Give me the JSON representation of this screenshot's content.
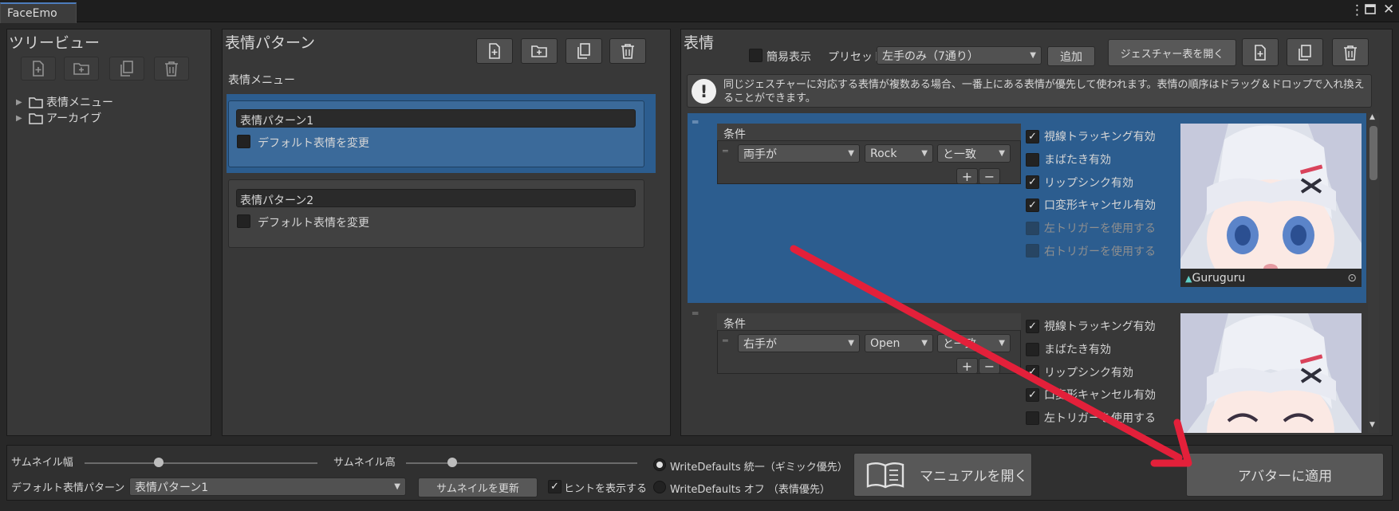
{
  "window": {
    "tab_title": "FaceEmo"
  },
  "tree": {
    "heading": "ツリービュー",
    "items": [
      {
        "label": "表情メニュー"
      },
      {
        "label": "アーカイブ"
      }
    ]
  },
  "patterns": {
    "heading": "表情パターン",
    "menu_label": "表情メニュー",
    "items": [
      {
        "name": "表情パターン1",
        "default_label": "デフォルト表情を変更",
        "selected": true
      },
      {
        "name": "表情パターン2",
        "default_label": "デフォルト表情を変更",
        "selected": false
      }
    ]
  },
  "expressions": {
    "heading": "表情",
    "simple_view_label": "簡易表示",
    "preset_label": "プリセット",
    "preset_value": "左手のみ（7通り）",
    "add_button": "追加",
    "open_gesture_table_button": "ジェスチャー表を開く",
    "hint": "同じジェスチャーに対応する表情が複数ある場合、一番上にある表情が優先して使われます。表情の順序はドラッグ＆ドロップで入れ換えることができます。",
    "condition_label": "条件",
    "items": [
      {
        "hand": "両手が",
        "gesture": "Rock",
        "match": "と一致",
        "options": [
          {
            "label": "視線トラッキング有効",
            "checked": true,
            "disabled": false
          },
          {
            "label": "まばたき有効",
            "checked": false,
            "disabled": false
          },
          {
            "label": "リップシンク有効",
            "checked": true,
            "disabled": false
          },
          {
            "label": "口変形キャンセル有効",
            "checked": true,
            "disabled": false
          },
          {
            "label": "左トリガーを使用する",
            "checked": false,
            "disabled": true
          },
          {
            "label": "右トリガーを使用する",
            "checked": false,
            "disabled": true
          }
        ],
        "animation_name": "Guruguru"
      },
      {
        "hand": "右手が",
        "gesture": "Open",
        "match": "と一致",
        "options": [
          {
            "label": "視線トラッキング有効",
            "checked": true,
            "disabled": false
          },
          {
            "label": "まばたき有効",
            "checked": false,
            "disabled": false
          },
          {
            "label": "リップシンク有効",
            "checked": true,
            "disabled": false
          },
          {
            "label": "口変形キャンセル有効",
            "checked": true,
            "disabled": false
          },
          {
            "label": "左トリガーを使用する",
            "checked": false,
            "disabled": false
          }
        ]
      }
    ],
    "plus": "+",
    "minus": "−"
  },
  "footer": {
    "thumb_width_label": "サムネイル幅",
    "thumb_height_label": "サムネイル高",
    "thumb_width_value": 0.32,
    "thumb_height_value": 0.2,
    "default_pattern_label": "デフォルト表情パターン",
    "default_pattern_value": "表情パターン1",
    "update_thumbnails_button": "サムネイルを更新",
    "show_hints_label": "ヒントを表示する",
    "write_defaults_on": "WriteDefaults 統一（ギミック優先）",
    "write_defaults_off": "WriteDefaults オフ （表情優先）",
    "manual_button": "マニュアルを開く",
    "apply_button": "アバターに適用"
  },
  "colors": {
    "selection": "#2c5d8f",
    "accent_arrow": "#e3203a"
  }
}
